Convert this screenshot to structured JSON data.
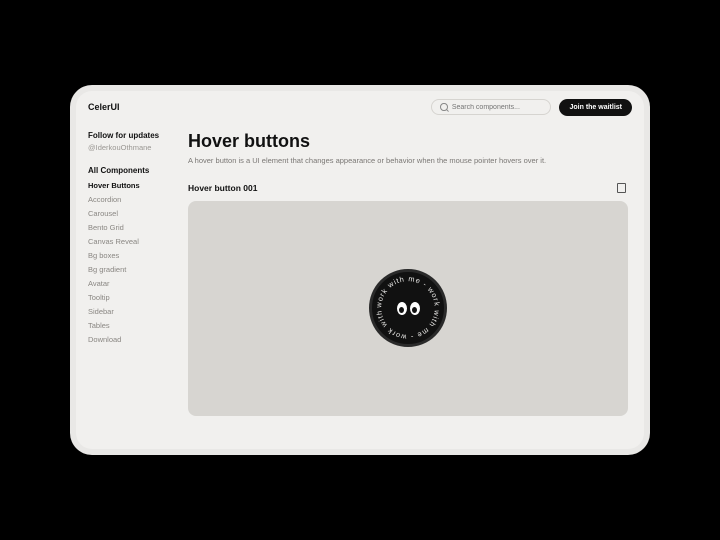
{
  "header": {
    "brand": "CelerUI",
    "search_placeholder": "Search components...",
    "cta_label": "Join the waitlist"
  },
  "sidebar": {
    "follow_title": "Follow for updates",
    "handle": "@IderkouOthmane",
    "nav_header": "All Components",
    "items": [
      {
        "label": "Hover Buttons",
        "active": true
      },
      {
        "label": "Accordion",
        "active": false
      },
      {
        "label": "Carousel",
        "active": false
      },
      {
        "label": "Bento Grid",
        "active": false
      },
      {
        "label": "Canvas Reveal",
        "active": false
      },
      {
        "label": "Bg boxes",
        "active": false
      },
      {
        "label": "Bg gradient",
        "active": false
      },
      {
        "label": "Avatar",
        "active": false
      },
      {
        "label": "Tooltip",
        "active": false
      },
      {
        "label": "Sidebar",
        "active": false
      },
      {
        "label": "Tables",
        "active": false
      },
      {
        "label": "Download",
        "active": false
      }
    ]
  },
  "main": {
    "title": "Hover buttons",
    "description": "A hover button is a UI element that changes appearance or behavior when the mouse pointer hovers over it.",
    "example_title": "Hover button 001",
    "badge_text": "work with me - work with me - work with me - "
  }
}
